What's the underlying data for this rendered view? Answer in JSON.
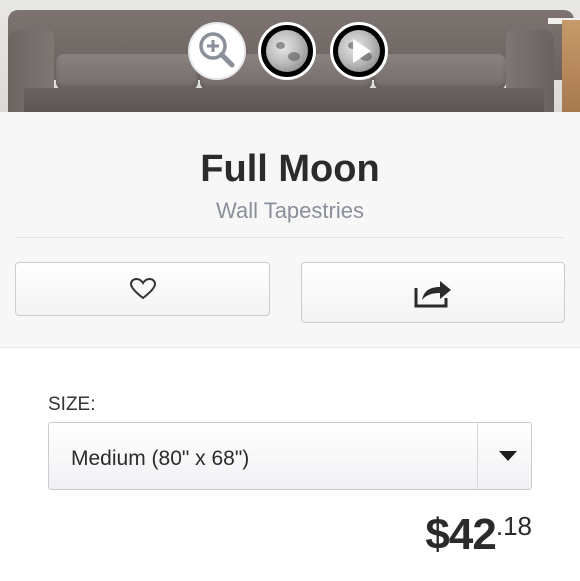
{
  "hero": {
    "thumbnails": [
      {
        "kind": "zoom",
        "icon": "zoom-in-icon"
      },
      {
        "kind": "image",
        "icon": "moon-icon"
      },
      {
        "kind": "video",
        "icon": "play-icon"
      }
    ]
  },
  "product": {
    "title": "Full Moon",
    "category": "Wall Tapestries"
  },
  "actions": {
    "favorite_icon": "heart-icon",
    "share_icon": "share-icon"
  },
  "size": {
    "label": "SIZE:",
    "selected": "Medium (80\" x 68\")"
  },
  "price": {
    "main": "$42",
    "cents": ".18"
  },
  "colors": {
    "accent": "#8a8f9a",
    "title": "#2b2b2d"
  }
}
